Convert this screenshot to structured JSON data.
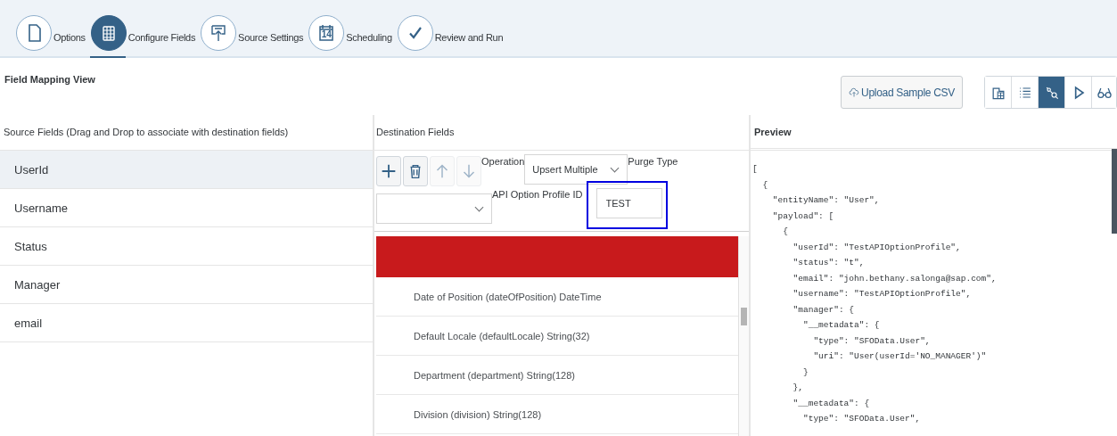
{
  "steps": [
    {
      "label": "Options",
      "selected": false
    },
    {
      "label": "Configure Fields",
      "selected": true
    },
    {
      "label": "Source Settings",
      "selected": false
    },
    {
      "label": "Scheduling",
      "selected": false,
      "icon_text": "14"
    },
    {
      "label": "Review and Run",
      "selected": false
    }
  ],
  "title": "Field Mapping View",
  "upload_button": "Upload Sample CSV",
  "view_buttons": [
    {
      "selected": false
    },
    {
      "selected": false
    },
    {
      "selected": true
    },
    {
      "selected": false
    },
    {
      "selected": false
    }
  ],
  "source": {
    "heading": "Source Fields (Drag and Drop to associate with destination fields)",
    "items": [
      {
        "label": "UserId",
        "selected": true
      },
      {
        "label": "Username",
        "selected": false
      },
      {
        "label": "Status",
        "selected": false
      },
      {
        "label": "Manager",
        "selected": false
      },
      {
        "label": "email",
        "selected": false
      }
    ]
  },
  "destination": {
    "heading": "Destination Fields",
    "tools": [
      {
        "disabled": false
      },
      {
        "disabled": false
      },
      {
        "disabled": true
      },
      {
        "disabled": true
      }
    ],
    "operation_label": "Operation",
    "operation_value": "Upsert Multiple",
    "purge_label": "Purge Type",
    "profile_label": "API Option Profile ID",
    "profile_value": "TEST",
    "rows": [
      {
        "error": true
      },
      {
        "label": "Date of Position (dateOfPosition) DateTime",
        "error": false
      },
      {
        "label": "Default Locale (defaultLocale) String(32)",
        "error": false
      },
      {
        "label": "Department (department) String(128)",
        "error": false
      },
      {
        "label": "Division (division) String(128)",
        "error": false
      }
    ]
  },
  "preview": {
    "heading": "Preview",
    "lines": [
      "[",
      "  {",
      "    \"entityName\": \"User\",",
      "    \"payload\": [",
      "      {",
      "        \"userId\": \"TestAPIOptionProfile\",",
      "        \"status\": \"t\",",
      "        \"email\": \"john.bethany.salonga@sap.com\",",
      "        \"username\": \"TestAPIOptionProfile\",",
      "        \"manager\": {",
      "          \"__metadata\": {",
      "            \"type\": \"SFOData.User\",",
      "            \"uri\": \"User(userId='NO_MANAGER')\"",
      "          }",
      "        },",
      "        \"__metadata\": {",
      "          \"type\": \"SFOData.User\","
    ]
  }
}
